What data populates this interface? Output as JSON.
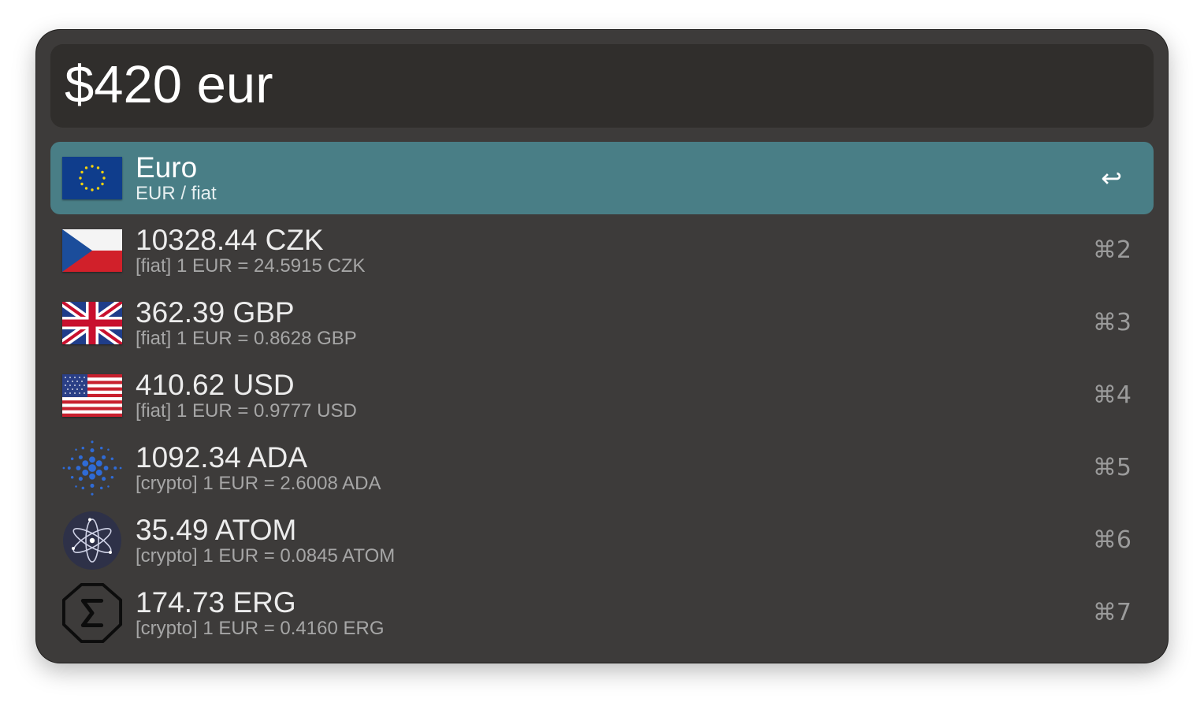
{
  "query": {
    "value": "$420 eur"
  },
  "results": [
    {
      "title": "Euro",
      "subtitle": "EUR / fiat",
      "shortcut": "↩",
      "icon": "eu-flag-icon",
      "selected": true
    },
    {
      "title": "10328.44 CZK",
      "subtitle": "[fiat] 1 EUR = 24.5915 CZK",
      "shortcut": "⌘2",
      "icon": "czech-flag-icon"
    },
    {
      "title": "362.39 GBP",
      "subtitle": "[fiat] 1 EUR = 0.8628 GBP",
      "shortcut": "⌘3",
      "icon": "uk-flag-icon"
    },
    {
      "title": "410.62 USD",
      "subtitle": "[fiat] 1 EUR = 0.9777 USD",
      "shortcut": "⌘4",
      "icon": "us-flag-icon"
    },
    {
      "title": "1092.34 ADA",
      "subtitle": "[crypto] 1 EUR = 2.6008 ADA",
      "shortcut": "⌘5",
      "icon": "cardano-icon"
    },
    {
      "title": "35.49 ATOM",
      "subtitle": "[crypto] 1 EUR = 0.0845 ATOM",
      "shortcut": "⌘6",
      "icon": "cosmos-atom-icon"
    },
    {
      "title": "174.73 ERG",
      "subtitle": "[crypto] 1 EUR = 0.4160 ERG",
      "shortcut": "⌘7",
      "icon": "ergo-icon"
    }
  ],
  "colors": {
    "window": "#3d3b3a",
    "query_bg": "#302e2c",
    "selected_row": "#497e86"
  }
}
